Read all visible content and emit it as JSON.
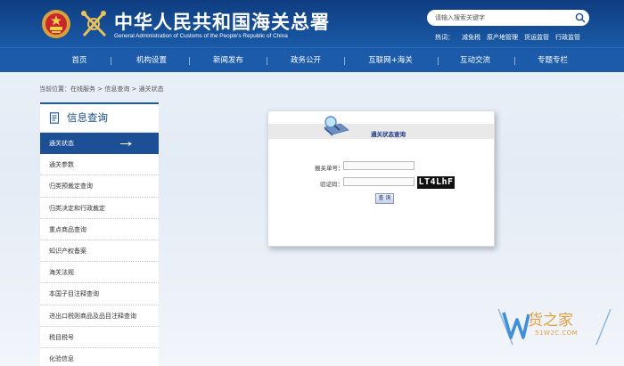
{
  "header": {
    "title": "中华人民共和国海关总署",
    "subtitle": "General Administration of Customs of the People's Republic of China",
    "search_placeholder": "请输入搜索关键字",
    "hot_label": "热词：",
    "hot_words": [
      "减免税",
      "原产地管理",
      "货运监管",
      "行政监管"
    ]
  },
  "nav": {
    "items": [
      "首页",
      "机构设置",
      "新闻发布",
      "政务公开",
      "互联网+海关",
      "互动交流",
      "专题专栏"
    ]
  },
  "breadcrumb": "当前位置：在线服务 > 信息查询 > 通关状态",
  "sidebar": {
    "title": "信息查询",
    "items": [
      "通关状态",
      "通关参数",
      "归类预裁定查询",
      "归类决定和行政裁定",
      "重点商品查询",
      "知识产权备案",
      "海关法规",
      "本国子目注释查询",
      "进出口税则商品及品目注释查询",
      "税目税号",
      "化验信息"
    ]
  },
  "query": {
    "title": "通关状态查询",
    "declaration_label": "报关单号：",
    "declaration_value": "",
    "captcha_label": "验证码：",
    "captcha_value": "",
    "captcha_image_text": "LT4LhF",
    "submit_label": "查 询"
  },
  "watermark": {
    "brand_text": "货之家",
    "url": "51W2C.COM"
  },
  "colors": {
    "header_bg": "#0f3d82",
    "nav_bg": "#1c5ba9",
    "sidebar_active": "#1c4f96",
    "watermark": "#e0a040"
  }
}
